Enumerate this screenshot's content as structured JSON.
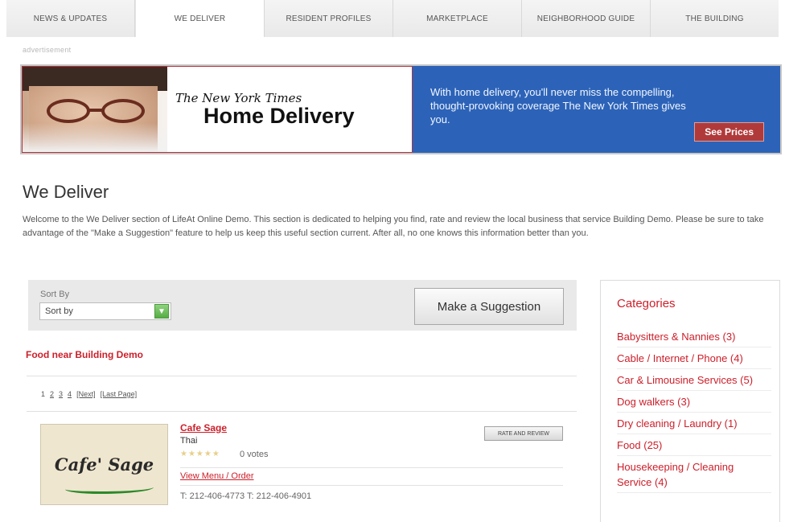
{
  "nav": {
    "tabs": [
      {
        "label": "NEWS & UPDATES"
      },
      {
        "label": "WE DELIVER"
      },
      {
        "label": "RESIDENT PROFILES"
      },
      {
        "label": "MARKETPLACE"
      },
      {
        "label": "NEIGHBORHOOD GUIDE"
      },
      {
        "label": "THE BUILDING"
      }
    ],
    "active_tab": "WE DELIVER"
  },
  "ad": {
    "label": "advertisement",
    "brand": "The New York Times",
    "headline": "Home Delivery",
    "body": "With home delivery, you'll never miss the compelling, thought-provoking coverage The New York Times gives you.",
    "cta": "See Prices",
    "colors": {
      "right_panel": "#2c63b8",
      "cta": "#b03a3a"
    }
  },
  "page": {
    "title": "We Deliver",
    "intro": "Welcome to the We Deliver section of LifeAt Online Demo. This section is dedicated to helping you find, rate and review the local business that service Building Demo. Please be sure to take advantage of the \"Make a Suggestion\" feature to help us keep this useful section current. After all, no one knows this information better than you."
  },
  "sort": {
    "label": "Sort By",
    "selected": "Sort by",
    "suggest_button": "Make a Suggestion"
  },
  "section": {
    "title": "Food near Building Demo",
    "pager": [
      "1",
      "2",
      "3",
      "4",
      "[Next]",
      "[Last Page]"
    ]
  },
  "listing": {
    "logo_text": "Cafe' Sage",
    "name": "Cafe Sage",
    "cuisine": "Thai",
    "stars": "★★★★★",
    "votes": "0 votes",
    "rate_button": "RATE AND REVIEW",
    "menu_link": "View Menu / Order",
    "phones": "T: 212-406-4773 T: 212-406-4901"
  },
  "categories": {
    "title": "Categories",
    "items": [
      "Babysitters & Nannies (3)",
      "Cable / Internet / Phone (4)",
      "Car & Limousine Services (5)",
      "Dog walkers (3)",
      "Dry cleaning / Laundry (1)",
      "Food (25)",
      "Housekeeping / Cleaning Service (4)"
    ]
  },
  "colors": {
    "accent": "#cc1f2a",
    "link": "#cc1f2a"
  }
}
